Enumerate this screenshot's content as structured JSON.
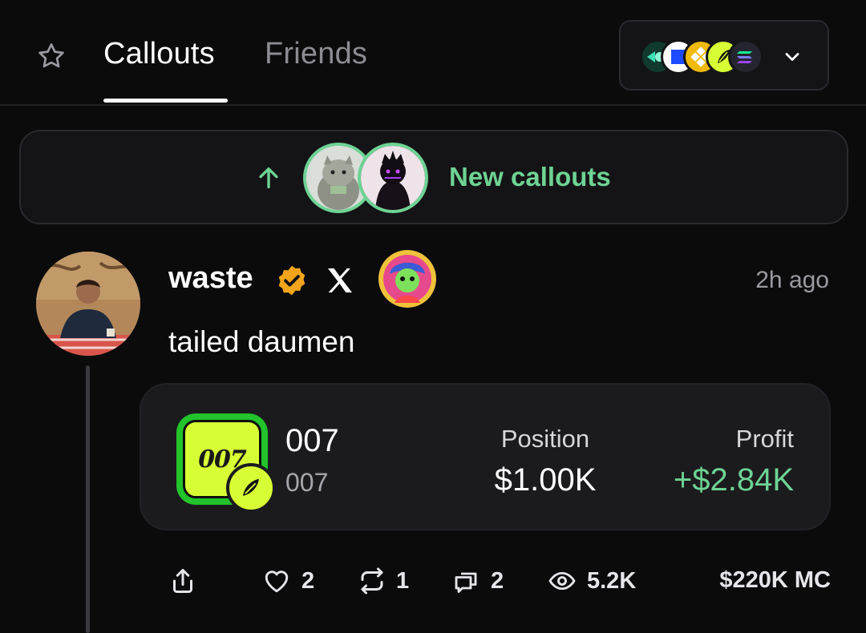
{
  "header": {
    "tabs": [
      {
        "label": "Callouts",
        "active": true
      },
      {
        "label": "Friends",
        "active": false
      }
    ],
    "chain_filter": {
      "icons": [
        "chain-icon-1",
        "chain-icon-2",
        "bnb-chain-icon",
        "pump-icon",
        "solana-icon"
      ]
    }
  },
  "banner": {
    "label": "New callouts",
    "accent": "#6ed394"
  },
  "post": {
    "author": "waste",
    "timestamp": "2h ago",
    "text": "tailed daumen",
    "token": {
      "name": "007",
      "symbol": "007",
      "logo_text": "007",
      "position_label": "Position",
      "position_value": "$1.00K",
      "profit_label": "Profit",
      "profit_value": "+$2.84K",
      "profit_color": "#6ed394"
    },
    "actions": {
      "likes": "2",
      "reposts": "1",
      "comments": "2",
      "views": "5.2K",
      "market_cap": "$220K MC"
    }
  }
}
